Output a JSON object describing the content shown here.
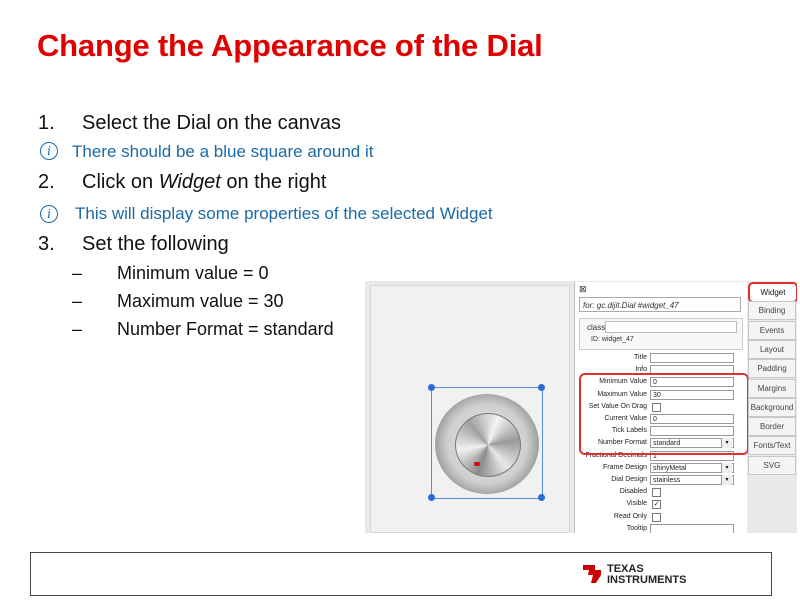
{
  "slide": {
    "title": "Change the Appearance of the Dial",
    "steps": [
      {
        "number": "1.",
        "text": "Select the Dial on the canvas"
      },
      {
        "number": "2.",
        "text_before": "Click on ",
        "text_italic": "Widget",
        "text_after": " on the right"
      },
      {
        "number": "3.",
        "text": "Set the following"
      }
    ],
    "notes": [
      "There should be a blue square around it",
      "This will display some properties of the selected Widget"
    ],
    "sub_items": [
      "Minimum value = 0",
      "Maximum value = 30",
      "Number Format = standard"
    ],
    "dash": "–"
  },
  "screenshot": {
    "for_label": "for: gc.dijit.Dial #widget_47",
    "class_label": "class:",
    "id_label": "ID: widget_47",
    "properties": [
      {
        "label": "Title",
        "value": "",
        "kind": "text"
      },
      {
        "label": "Info",
        "value": "",
        "kind": "text"
      },
      {
        "label": "Minimum Value",
        "value": "0",
        "kind": "text"
      },
      {
        "label": "Maximum Value",
        "value": "30",
        "kind": "text"
      },
      {
        "label": "Set Value On Drag",
        "value": "",
        "kind": "check"
      },
      {
        "label": "Current Value",
        "value": "0",
        "kind": "text"
      },
      {
        "label": "Tick Labels",
        "value": "",
        "kind": "text"
      },
      {
        "label": "Number Format",
        "value": "standard",
        "kind": "select"
      },
      {
        "label": "Fractional Decimals",
        "value": "1",
        "kind": "text"
      },
      {
        "label": "Frame Design",
        "value": "shinyMetal",
        "kind": "select"
      },
      {
        "label": "Dial Design",
        "value": "stainless",
        "kind": "select"
      },
      {
        "label": "Disabled",
        "value": "",
        "kind": "check"
      },
      {
        "label": "Visible",
        "value": "✓",
        "kind": "check"
      },
      {
        "label": "Read Only",
        "value": "",
        "kind": "check"
      },
      {
        "label": "Tooltip",
        "value": "",
        "kind": "text"
      }
    ],
    "tabs": [
      "Widget",
      "Binding",
      "Events",
      "Layout",
      "Padding",
      "Margins",
      "Background",
      "Border",
      "Fonts/Text",
      "SVG"
    ],
    "active_tab": "Widget"
  },
  "footer": {
    "logo_line1": "TEXAS",
    "logo_line2": "INSTRUMENTS"
  },
  "colors": {
    "title": "#e00000",
    "note": "#1a6aa8",
    "highlight": "#e03030",
    "selection": "#2d6bd3"
  }
}
